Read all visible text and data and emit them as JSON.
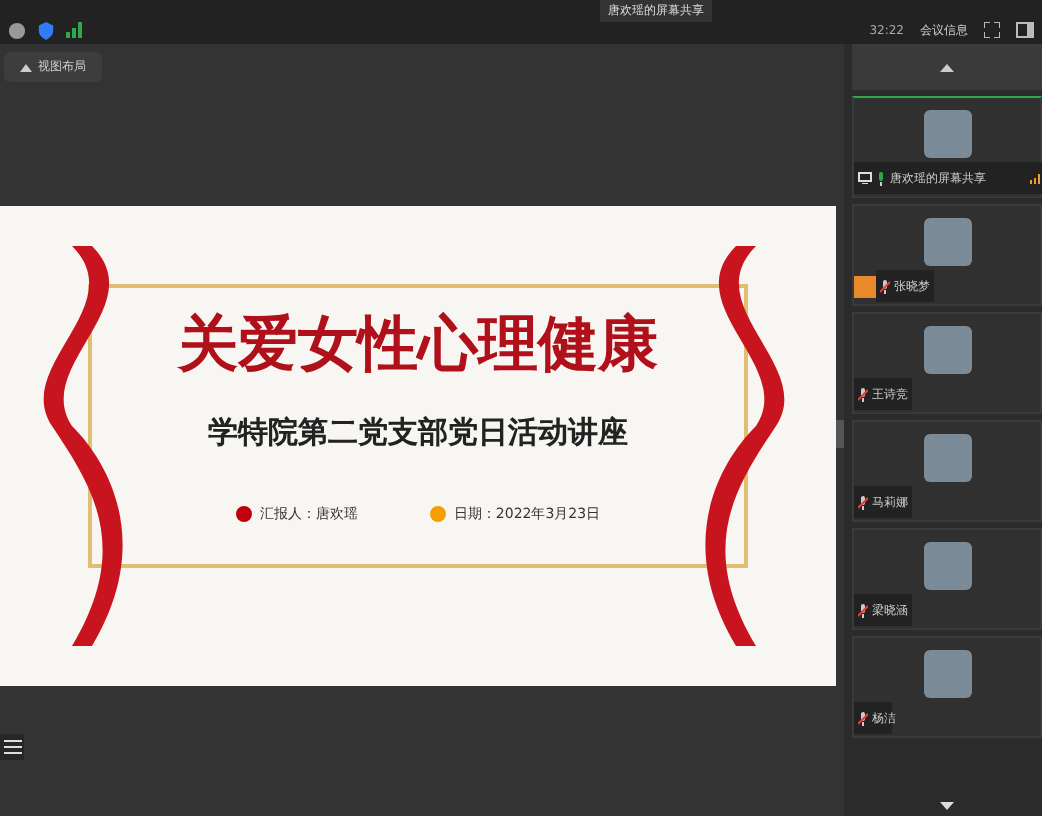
{
  "top_bar": {
    "center_title": "唐欢瑶的屏幕共享",
    "time": "32:22",
    "meeting_info": "会议信息"
  },
  "view_button": {
    "label": "视图布局"
  },
  "slide": {
    "title": "关爱女性心理健康",
    "subtitle": "学特院第二党支部党日活动讲座",
    "items": [
      {
        "text": "汇报人：唐欢瑶",
        "color": "#c0000a"
      },
      {
        "text": "日期：2022年3月23日",
        "color": "#f5a000"
      }
    ]
  },
  "participants": [
    {
      "name": "唐欢瑶的屏幕共享",
      "muted": false,
      "sharing": true,
      "hand_raised": false,
      "selected": true
    },
    {
      "name": "张晓梦",
      "muted": true,
      "sharing": false,
      "hand_raised": true,
      "selected": false
    },
    {
      "name": "王诗竞",
      "muted": true,
      "sharing": false,
      "hand_raised": false,
      "selected": false
    },
    {
      "name": "马莉娜",
      "muted": true,
      "sharing": false,
      "hand_raised": false,
      "selected": false
    },
    {
      "name": "梁晓涵",
      "muted": true,
      "sharing": false,
      "hand_raised": false,
      "selected": false
    },
    {
      "name": "杨洁",
      "muted": true,
      "sharing": false,
      "hand_raised": false,
      "selected": false
    }
  ]
}
